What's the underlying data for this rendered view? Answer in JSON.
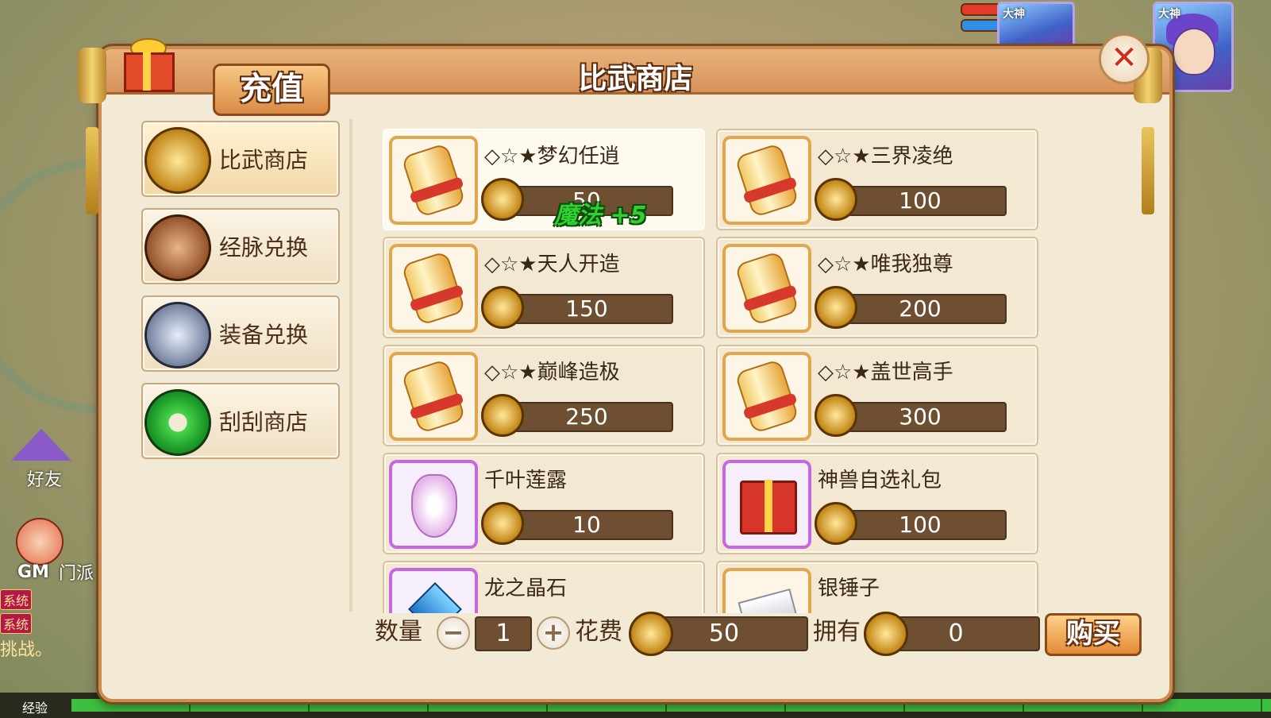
{
  "window": {
    "title": "比武商店"
  },
  "recharge": {
    "label": "充值"
  },
  "close_icon": "close-icon",
  "hud": {
    "portrait_left_label": "大神",
    "portrait_right_label": "大神",
    "friends_label": "好友",
    "gm_label": "GM",
    "sect_label": "门派",
    "chat": {
      "tag1": "系统",
      "tag2": "系统",
      "line_bottom": "挑战。"
    },
    "exp_label": "经验"
  },
  "sidebar": {
    "items": [
      {
        "label": "比武商店",
        "icon": "gold-medal-icon",
        "active": true
      },
      {
        "label": "经脉兑换",
        "icon": "bronze-sword-medal-icon",
        "active": false
      },
      {
        "label": "装备兑换",
        "icon": "silver-sword-medal-icon",
        "active": false
      },
      {
        "label": "刮刮商店",
        "icon": "jade-ring-icon",
        "active": false
      }
    ]
  },
  "shop": {
    "items": [
      {
        "name": "◇☆★梦幻任逍",
        "price": "50",
        "icon": "scroll-icon",
        "selected": true,
        "buff": "魔法 +5"
      },
      {
        "name": "◇☆★三界凌绝",
        "price": "100",
        "icon": "scroll-icon"
      },
      {
        "name": "◇☆★天人开造",
        "price": "150",
        "icon": "scroll-icon"
      },
      {
        "name": "◇☆★唯我独尊",
        "price": "200",
        "icon": "scroll-icon"
      },
      {
        "name": "◇☆★巅峰造极",
        "price": "250",
        "icon": "scroll-icon"
      },
      {
        "name": "◇☆★盖世高手",
        "price": "300",
        "icon": "scroll-icon"
      },
      {
        "name": "千叶莲露",
        "price": "10",
        "icon": "vase-icon"
      },
      {
        "name": "神兽自选礼包",
        "price": "100",
        "icon": "gift-box-icon"
      },
      {
        "name": "龙之晶石",
        "price": "",
        "icon": "crystal-icon"
      },
      {
        "name": "银锤子",
        "price": "",
        "icon": "hammer-icon"
      }
    ]
  },
  "purchase": {
    "quantity_label": "数量",
    "quantity": "1",
    "minus": "−",
    "plus": "+",
    "cost_label": "花费",
    "cost": "50",
    "owned_label": "拥有",
    "owned": "0",
    "buy_label": "购买"
  }
}
